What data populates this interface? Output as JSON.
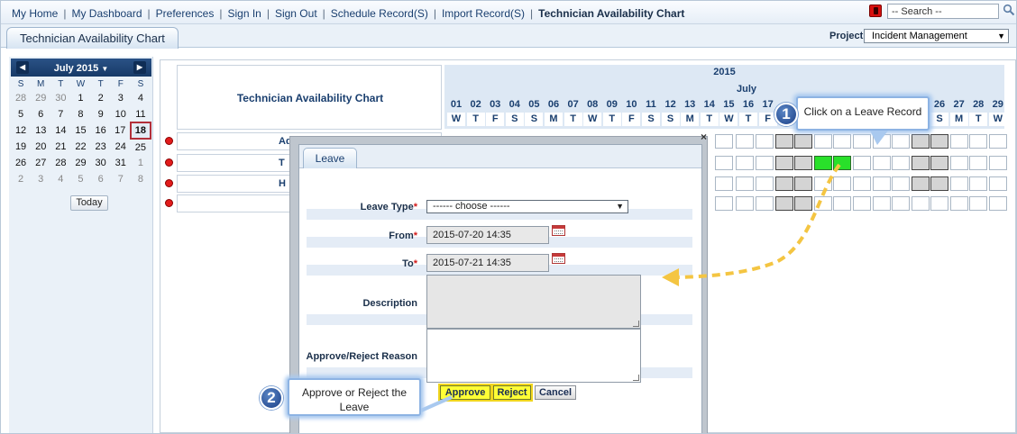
{
  "nav": {
    "links": [
      "My Home",
      "My Dashboard",
      "Preferences",
      "Sign In",
      "Sign Out",
      "Schedule Record(S)",
      "Import Record(S)"
    ],
    "current": "Technician Availability Chart"
  },
  "search": {
    "value": "-- Search --"
  },
  "tab": {
    "label": "Technician Availability Chart"
  },
  "project": {
    "label": "Project",
    "value": "Incident Management"
  },
  "calendar": {
    "title": "July 2015",
    "dow": [
      "S",
      "M",
      "T",
      "W",
      "T",
      "F",
      "S"
    ],
    "weeks": [
      [
        "28",
        "29",
        "30",
        "1",
        "2",
        "3",
        "4"
      ],
      [
        "5",
        "6",
        "7",
        "8",
        "9",
        "10",
        "11"
      ],
      [
        "12",
        "13",
        "14",
        "15",
        "16",
        "17",
        "18"
      ],
      [
        "19",
        "20",
        "21",
        "22",
        "23",
        "24",
        "25"
      ],
      [
        "26",
        "27",
        "28",
        "29",
        "30",
        "31",
        "1"
      ],
      [
        "2",
        "3",
        "4",
        "5",
        "6",
        "7",
        "8"
      ]
    ],
    "today_label": "Today",
    "selected": "18"
  },
  "chart": {
    "title": "Technician Availability Chart",
    "year": "2015",
    "month": "July",
    "days": [
      "01",
      "02",
      "03",
      "04",
      "05",
      "06",
      "07",
      "08",
      "09",
      "10",
      "11",
      "12",
      "13",
      "14",
      "15",
      "16",
      "17"
    ],
    "dows": [
      "W",
      "T",
      "F",
      "S",
      "S",
      "M",
      "T",
      "W",
      "T",
      "F",
      "S",
      "S",
      "M",
      "T",
      "W",
      "T",
      "F"
    ],
    "days_right": [
      "26",
      "27",
      "28",
      "29"
    ],
    "dows_right": [
      "S",
      "M",
      "T",
      "W"
    ],
    "rows": [
      {
        "name": "Ad"
      },
      {
        "name": "T"
      },
      {
        "name": "H"
      },
      {
        "name": ""
      }
    ]
  },
  "dialog": {
    "tab": "Leave",
    "leave_type": {
      "label": "Leave Type",
      "value": "------ choose ------"
    },
    "from": {
      "label": "From",
      "value": "2015-07-20 14:35"
    },
    "to": {
      "label": "To",
      "value": "2015-07-21 14:35"
    },
    "description": {
      "label": "Description"
    },
    "reason": {
      "label": "Approve/Reject Reason"
    },
    "buttons": {
      "approve": "Approve",
      "reject": "Reject",
      "cancel": "Cancel"
    },
    "close": "×"
  },
  "callouts": {
    "one": {
      "number": "1",
      "text": "Click on a Leave Record"
    },
    "two": {
      "number": "2",
      "text": "Approve or Reject the Leave"
    }
  },
  "colors": {
    "accent": "#1a3f6f",
    "leave_green": "#29e02a",
    "booked_gray": "#d4d4d4",
    "highlight_yellow": "#ffff35",
    "arrow": "#f4c542"
  }
}
